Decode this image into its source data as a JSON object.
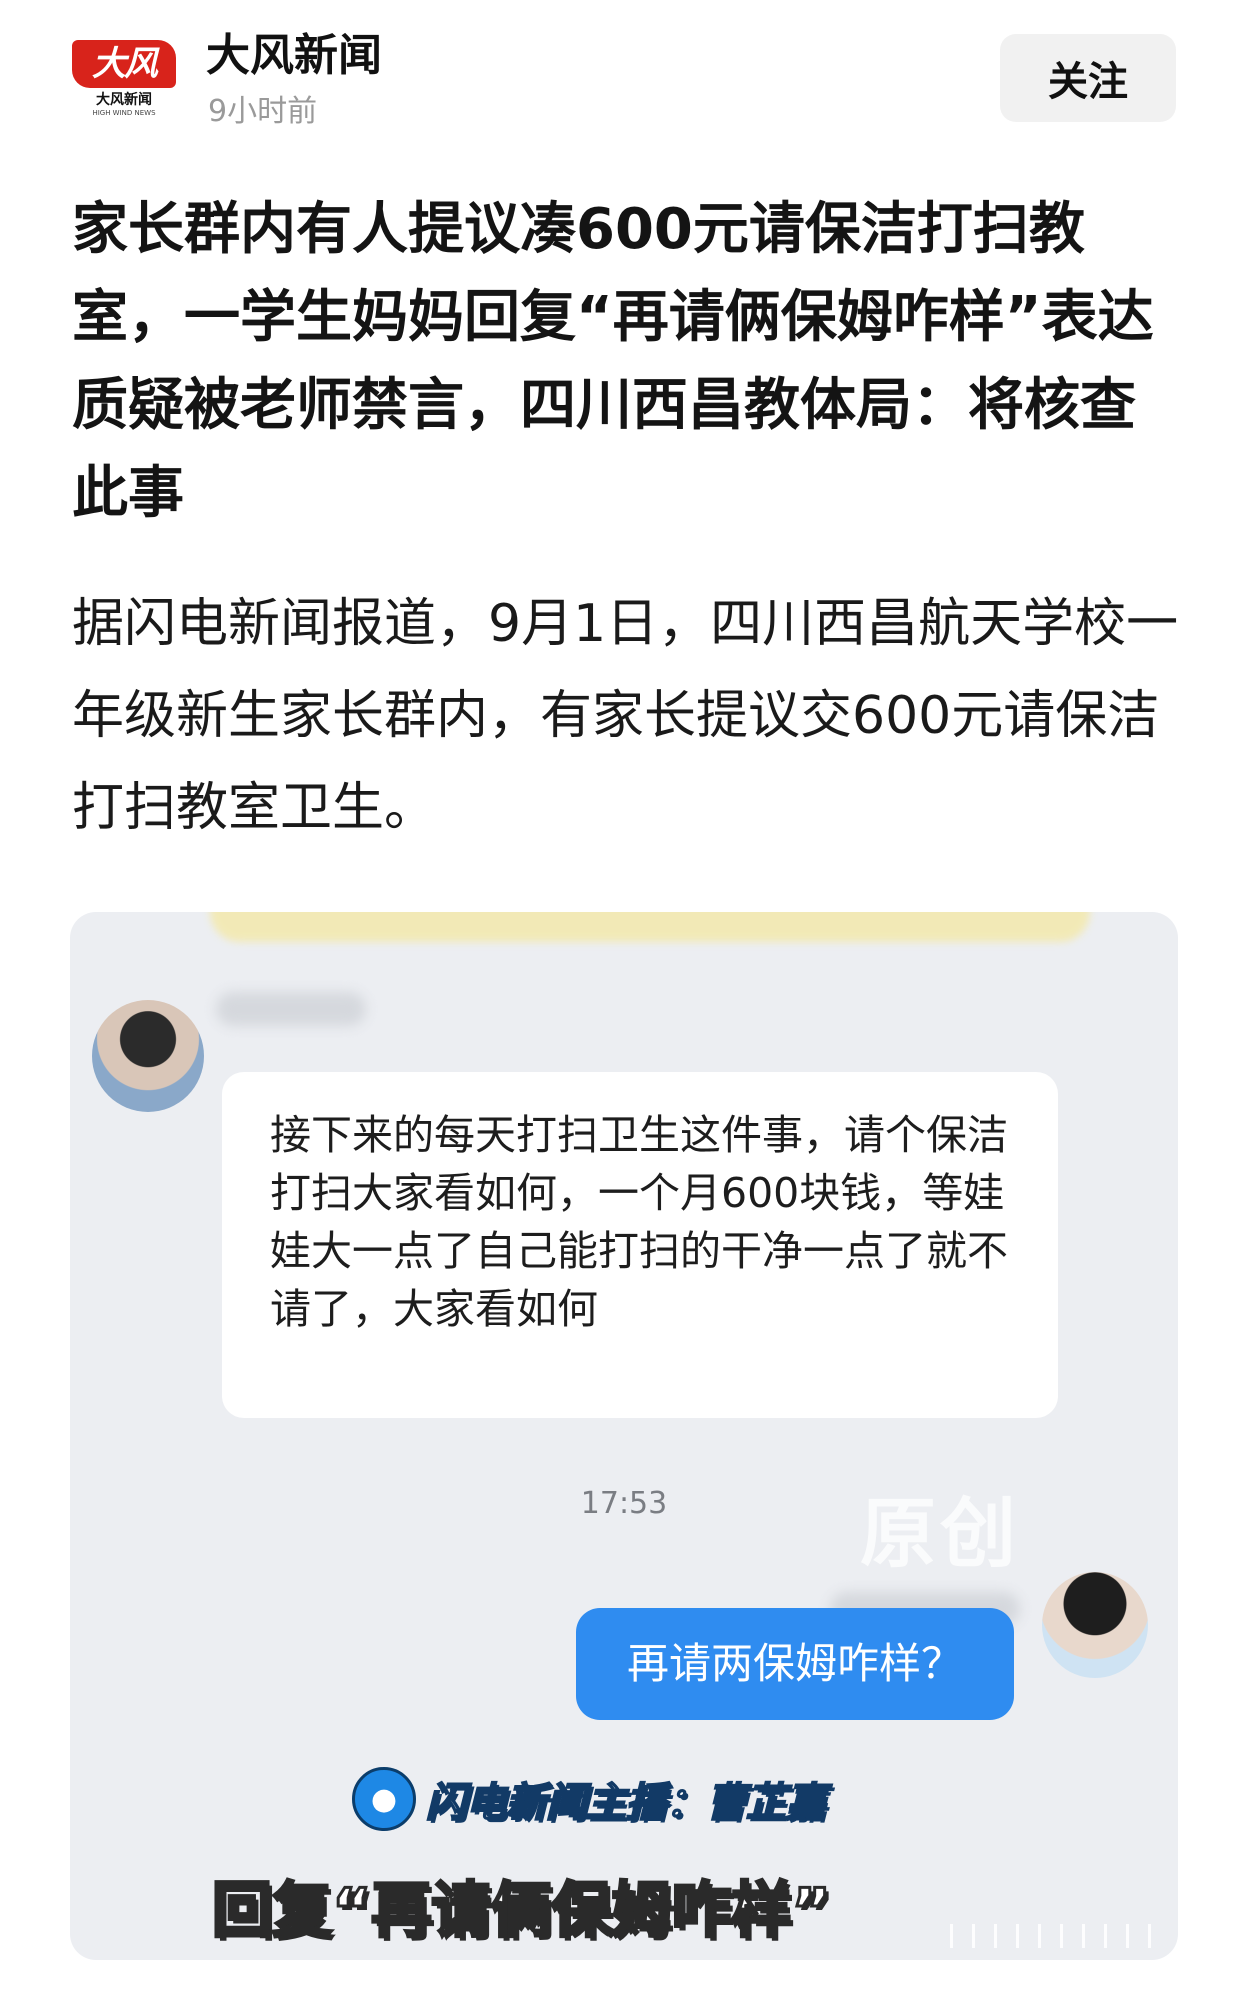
{
  "header": {
    "logo_mark": "大风",
    "logo_name": "大风新闻",
    "logo_en": "HIGH WIND NEWS",
    "source_name": "大风新闻",
    "time": "9小时前",
    "follow_label": "关注"
  },
  "article": {
    "headline": "家长群内有人提议凑600元请保洁打扫教室，一学生妈妈回复“再请俩保姆咋样”表达质疑被老师禁言，四川西昌教体局：将核查此事",
    "body": "据闪电新闻报道，9月1日，四川西昌航天学校一年级新生家长群内，有家长提议交600元请保洁打扫教室卫生。"
  },
  "media": {
    "left_message": "接下来的每天打扫卫生这件事，请个保洁打扫大家看如何，一个月600块钱，等娃娃大一点了自己能打扫的干净一点了就不请了，大家看如何",
    "timestamp": "17:53",
    "watermark": "原创",
    "right_message": "再请两保姆咋样？",
    "anchor": "闪电新闻主播：曹芷嘉",
    "subtitle": "回复“再请俩保姆咋样”"
  },
  "icons": {
    "mic": "microphone-icon"
  },
  "colors": {
    "brand_red": "#d8231b",
    "bubble_blue": "#2f8cf0",
    "follow_bg": "#f1f1f1"
  }
}
